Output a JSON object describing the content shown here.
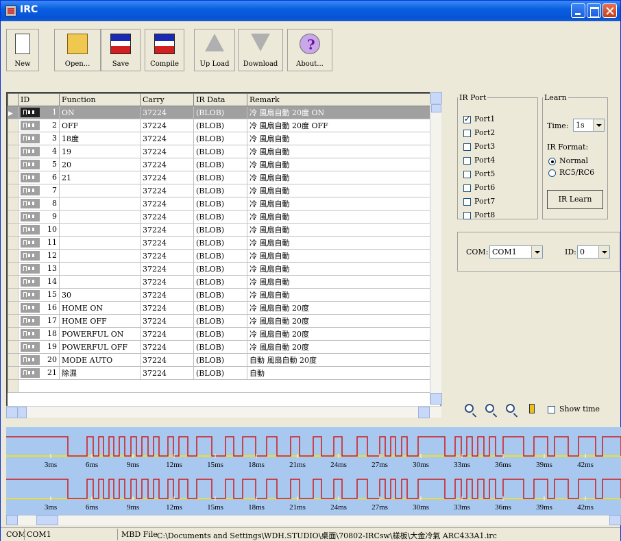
{
  "window": {
    "title": "IRC"
  },
  "toolbar": [
    {
      "label": "New",
      "icon": "new-file-icon"
    },
    {
      "label": "Open...",
      "icon": "open-folder-icon"
    },
    {
      "label": "Save",
      "icon": "floppy-disk-icon"
    },
    {
      "label": "Compile",
      "icon": "compile-disk-icon"
    },
    {
      "label": "Up Load",
      "icon": "up-arrow-icon"
    },
    {
      "label": "Download",
      "icon": "down-arrow-icon"
    },
    {
      "label": "About...",
      "icon": "help-question-icon"
    }
  ],
  "grid": {
    "headers": [
      "ID",
      "Function",
      "Carry",
      "IR Data",
      "Remark"
    ],
    "rows": [
      {
        "id": "1",
        "function": "ON",
        "carry": "37224",
        "irdata": "(BLOB)",
        "remark": "冷 風扇自動 20度 ON",
        "selected": true
      },
      {
        "id": "2",
        "function": "OFF",
        "carry": "37224",
        "irdata": "(BLOB)",
        "remark": "冷 風扇自動 20度 OFF"
      },
      {
        "id": "3",
        "function": "18度",
        "carry": "37224",
        "irdata": "(BLOB)",
        "remark": "冷 風扇自動"
      },
      {
        "id": "4",
        "function": "19",
        "carry": "37224",
        "irdata": "(BLOB)",
        "remark": "冷 風扇自動"
      },
      {
        "id": "5",
        "function": "20",
        "carry": "37224",
        "irdata": "(BLOB)",
        "remark": "冷 風扇自動"
      },
      {
        "id": "6",
        "function": "21",
        "carry": "37224",
        "irdata": "(BLOB)",
        "remark": "冷 風扇自動"
      },
      {
        "id": "7",
        "function": "",
        "carry": "37224",
        "irdata": "(BLOB)",
        "remark": "冷 風扇自動"
      },
      {
        "id": "8",
        "function": "",
        "carry": "37224",
        "irdata": "(BLOB)",
        "remark": "冷 風扇自動"
      },
      {
        "id": "9",
        "function": "",
        "carry": "37224",
        "irdata": "(BLOB)",
        "remark": "冷 風扇自動"
      },
      {
        "id": "10",
        "function": "",
        "carry": "37224",
        "irdata": "(BLOB)",
        "remark": "冷 風扇自動"
      },
      {
        "id": "11",
        "function": "",
        "carry": "37224",
        "irdata": "(BLOB)",
        "remark": "冷 風扇自動"
      },
      {
        "id": "12",
        "function": "",
        "carry": "37224",
        "irdata": "(BLOB)",
        "remark": "冷 風扇自動"
      },
      {
        "id": "13",
        "function": "",
        "carry": "37224",
        "irdata": "(BLOB)",
        "remark": "冷 風扇自動"
      },
      {
        "id": "14",
        "function": "",
        "carry": "37224",
        "irdata": "(BLOB)",
        "remark": "冷 風扇自動"
      },
      {
        "id": "15",
        "function": "30",
        "carry": "37224",
        "irdata": "(BLOB)",
        "remark": "冷 風扇自動"
      },
      {
        "id": "16",
        "function": "HOME ON",
        "carry": "37224",
        "irdata": "(BLOB)",
        "remark": "冷 風扇自動 20度"
      },
      {
        "id": "17",
        "function": "HOME OFF",
        "carry": "37224",
        "irdata": "(BLOB)",
        "remark": "冷 風扇自動 20度"
      },
      {
        "id": "18",
        "function": "POWERFUL ON",
        "carry": "37224",
        "irdata": "(BLOB)",
        "remark": "冷 風扇自動 20度"
      },
      {
        "id": "19",
        "function": "POWERFUL OFF",
        "carry": "37224",
        "irdata": "(BLOB)",
        "remark": "冷 風扇自動 20度"
      },
      {
        "id": "20",
        "function": "MODE AUTO",
        "carry": "37224",
        "irdata": "(BLOB)",
        "remark": "自動 風扇自動 20度"
      },
      {
        "id": "21",
        "function": "除濕",
        "carry": "37224",
        "irdata": "(BLOB)",
        "remark": "自動"
      }
    ]
  },
  "irport": {
    "legend": "IR Port",
    "ports": [
      {
        "label": "Port1",
        "checked": true
      },
      {
        "label": "Port2",
        "checked": false
      },
      {
        "label": "Port3",
        "checked": false
      },
      {
        "label": "Port4",
        "checked": false
      },
      {
        "label": "Port5",
        "checked": false
      },
      {
        "label": "Port6",
        "checked": false
      },
      {
        "label": "Port7",
        "checked": false
      },
      {
        "label": "Port8",
        "checked": false
      }
    ]
  },
  "learn": {
    "legend": "Learn",
    "time_label": "Time:",
    "time_value": "1s",
    "format_label": "IR Format:",
    "formats": [
      {
        "label": "Normal",
        "selected": true
      },
      {
        "label": "RC5/RC6",
        "selected": false
      }
    ],
    "button": "IR Learn"
  },
  "com": {
    "label": "COM:",
    "value": "COM1",
    "id_label": "ID:",
    "id_value": "0"
  },
  "zoom": {
    "show_label": "Show time"
  },
  "waveform": {
    "ticks": [
      "3ms",
      "6ms",
      "9ms",
      "12ms",
      "15ms",
      "18ms",
      "21ms",
      "24ms",
      "27ms",
      "30ms",
      "33ms",
      "36ms",
      "39ms",
      "42ms"
    ],
    "line_color": "#d01818",
    "axis_color": "#f0e020",
    "bg_color": "#a8c8f0"
  },
  "status": {
    "com_label": "COM",
    "com_value": "COM1",
    "file_label": "MBD File",
    "file_path": "C:\\Documents and Settings\\WDH.STUDIO\\桌面\\70802-IRCsw\\樣板\\大金冷氣 ARC433A1.irc"
  }
}
